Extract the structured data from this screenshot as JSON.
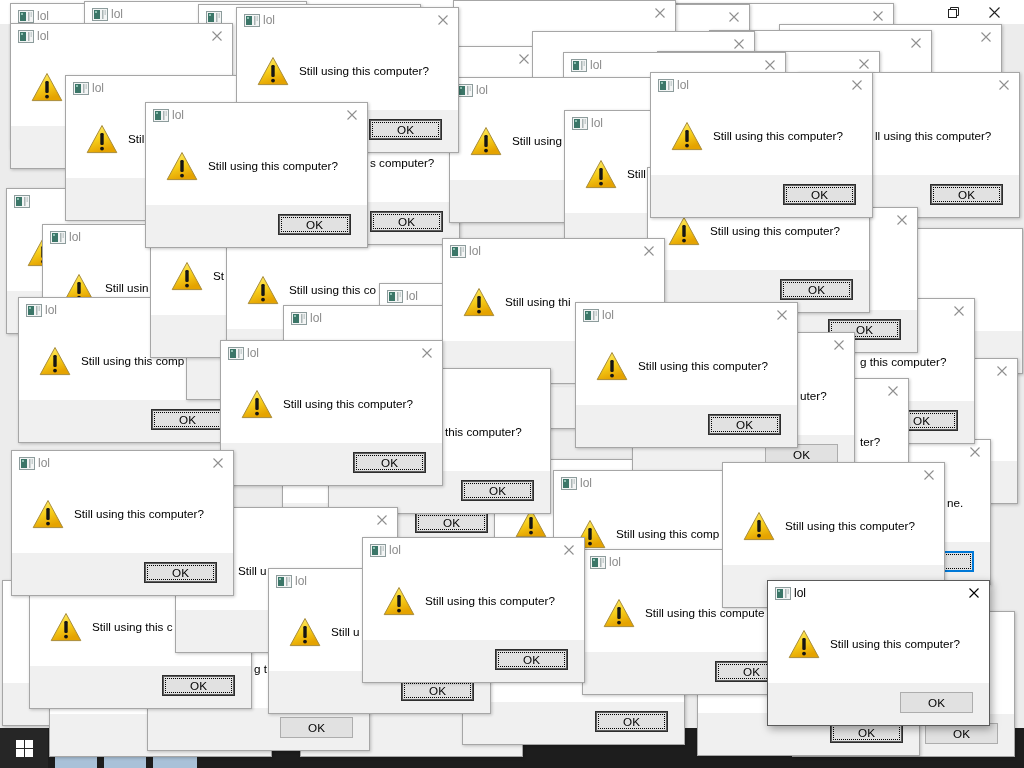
{
  "desktop": {
    "dialogs": [
      {
        "title": "lol",
        "active": false
      },
      {
        "title": "lol",
        "active": false
      },
      {
        "title": "lol",
        "active": false
      },
      {
        "title": "lol",
        "message": "Stil",
        "active": false
      },
      {
        "title": "lol",
        "message": "Still using this computer?",
        "button": {
          "label": "OK",
          "focused": true,
          "highlighted": false
        },
        "active": false
      },
      {
        "title": "lol",
        "message": "Still using this computer?",
        "button": {
          "label": "OK",
          "focused": true,
          "highlighted": false
        },
        "active": false
      },
      {
        "message": "s computer?",
        "button": {
          "label": "OK",
          "focused": true,
          "highlighted": false
        },
        "active": false
      },
      {
        "active": false
      },
      {
        "active": false
      },
      {
        "active": false
      },
      {
        "active": false
      },
      {
        "title": "lol",
        "active": false
      },
      {
        "active": false
      },
      {
        "active": false
      },
      {
        "active": false
      },
      {
        "active": false
      },
      {
        "title": "lol",
        "message": "Still using",
        "active": false
      },
      {
        "title": "lol",
        "message": "Still",
        "active": false
      },
      {
        "title": "lol",
        "message": "Still using this computer?",
        "button": {
          "label": "OK",
          "focused": true,
          "highlighted": false
        },
        "active": false
      },
      {
        "message": "ll using this computer?",
        "button": {
          "label": "OK",
          "focused": true,
          "highlighted": false
        },
        "active": false
      },
      {
        "title": "lol",
        "message": "Still usin",
        "active": false
      },
      {
        "message": "St"
      },
      {
        "message": "Still using this co"
      },
      {
        "title": "lol",
        "active": false
      },
      {
        "title": "lol",
        "message": "Still using thi",
        "active": false
      },
      {
        "message": "Still using this computer?",
        "button": {
          "label": "OK",
          "focused": true,
          "highlighted": false
        },
        "active": false
      },
      {
        "title": "lol",
        "message": "Still using this comp",
        "button": {
          "label": "OK",
          "focused": true,
          "highlighted": false
        },
        "active": false
      },
      {
        "title": "lol",
        "active": false
      },
      {
        "title": "lol",
        "message": "Still using this computer?",
        "button": {
          "label": "OK",
          "focused": true,
          "highlighted": false
        },
        "active": false
      },
      {
        "title": "lol",
        "message": "Still using this computer?",
        "button": {
          "label": "OK",
          "focused": true,
          "highlighted": false
        },
        "active": false
      },
      {
        "title": "lol",
        "message": "Still using this computer?",
        "button": {
          "label": "OK",
          "focused": true,
          "highlighted": false
        },
        "active": false
      },
      {
        "button": {
          "label": "OK",
          "focused": true,
          "highlighted": false
        },
        "active": false
      },
      {
        "message": "this computer?",
        "button": {
          "label": "OK",
          "focused": true,
          "highlighted": false
        },
        "active": false
      },
      {
        "message": "uter?",
        "button": {
          "label": "OK",
          "focused": false,
          "highlighted": false
        },
        "active": false
      },
      {
        "message": "g this computer?",
        "button": {
          "label": "OK",
          "focused": true,
          "highlighted": false
        },
        "active": false
      },
      {
        "active": false
      },
      {
        "message": "ter?",
        "active": false
      },
      {
        "button": {
          "label": "OK",
          "focused": true,
          "highlighted": false
        },
        "active": false
      },
      {
        "title": "lol",
        "message": "Still using this comp",
        "active": false
      },
      {
        "message": "ne.",
        "button": {
          "focused": true,
          "highlighted": true
        },
        "active": false
      },
      {
        "message": "Still using this computer?",
        "active": false
      },
      {
        "message": "Still u",
        "active": false
      },
      {
        "message": "Still using this c",
        "button": {
          "label": "OK",
          "focused": true,
          "highlighted": false
        },
        "active": false
      },
      {
        "title": "lol",
        "message": "Still u",
        "button": {
          "label": "OK",
          "focused": true,
          "highlighted": false
        },
        "active": false
      },
      {
        "title": "lol",
        "message": "Still using this computer?",
        "button": {
          "label": "OK",
          "focused": true,
          "highlighted": false
        },
        "active": false
      },
      {
        "message": "g t",
        "button": {
          "label": "OK",
          "focused": false,
          "highlighted": false
        },
        "active": false
      },
      {
        "title": "lol",
        "message": "Still using this compute",
        "button": {
          "label": "OK",
          "focused": true,
          "highlighted": false
        },
        "active": false
      },
      {
        "title": "lol",
        "message": "Still using this computer?",
        "button": {
          "label": "OK",
          "focused": false,
          "highlighted": false
        },
        "active": true
      },
      {
        "button": {
          "label": "OK",
          "focused": true,
          "highlighted": false
        },
        "active": false
      },
      {
        "button": {
          "label": "OK",
          "focused": true,
          "highlighted": false
        },
        "active": false
      },
      {
        "button": {
          "label": "OK",
          "focused": false,
          "highlighted": false
        },
        "active": false
      }
    ]
  }
}
